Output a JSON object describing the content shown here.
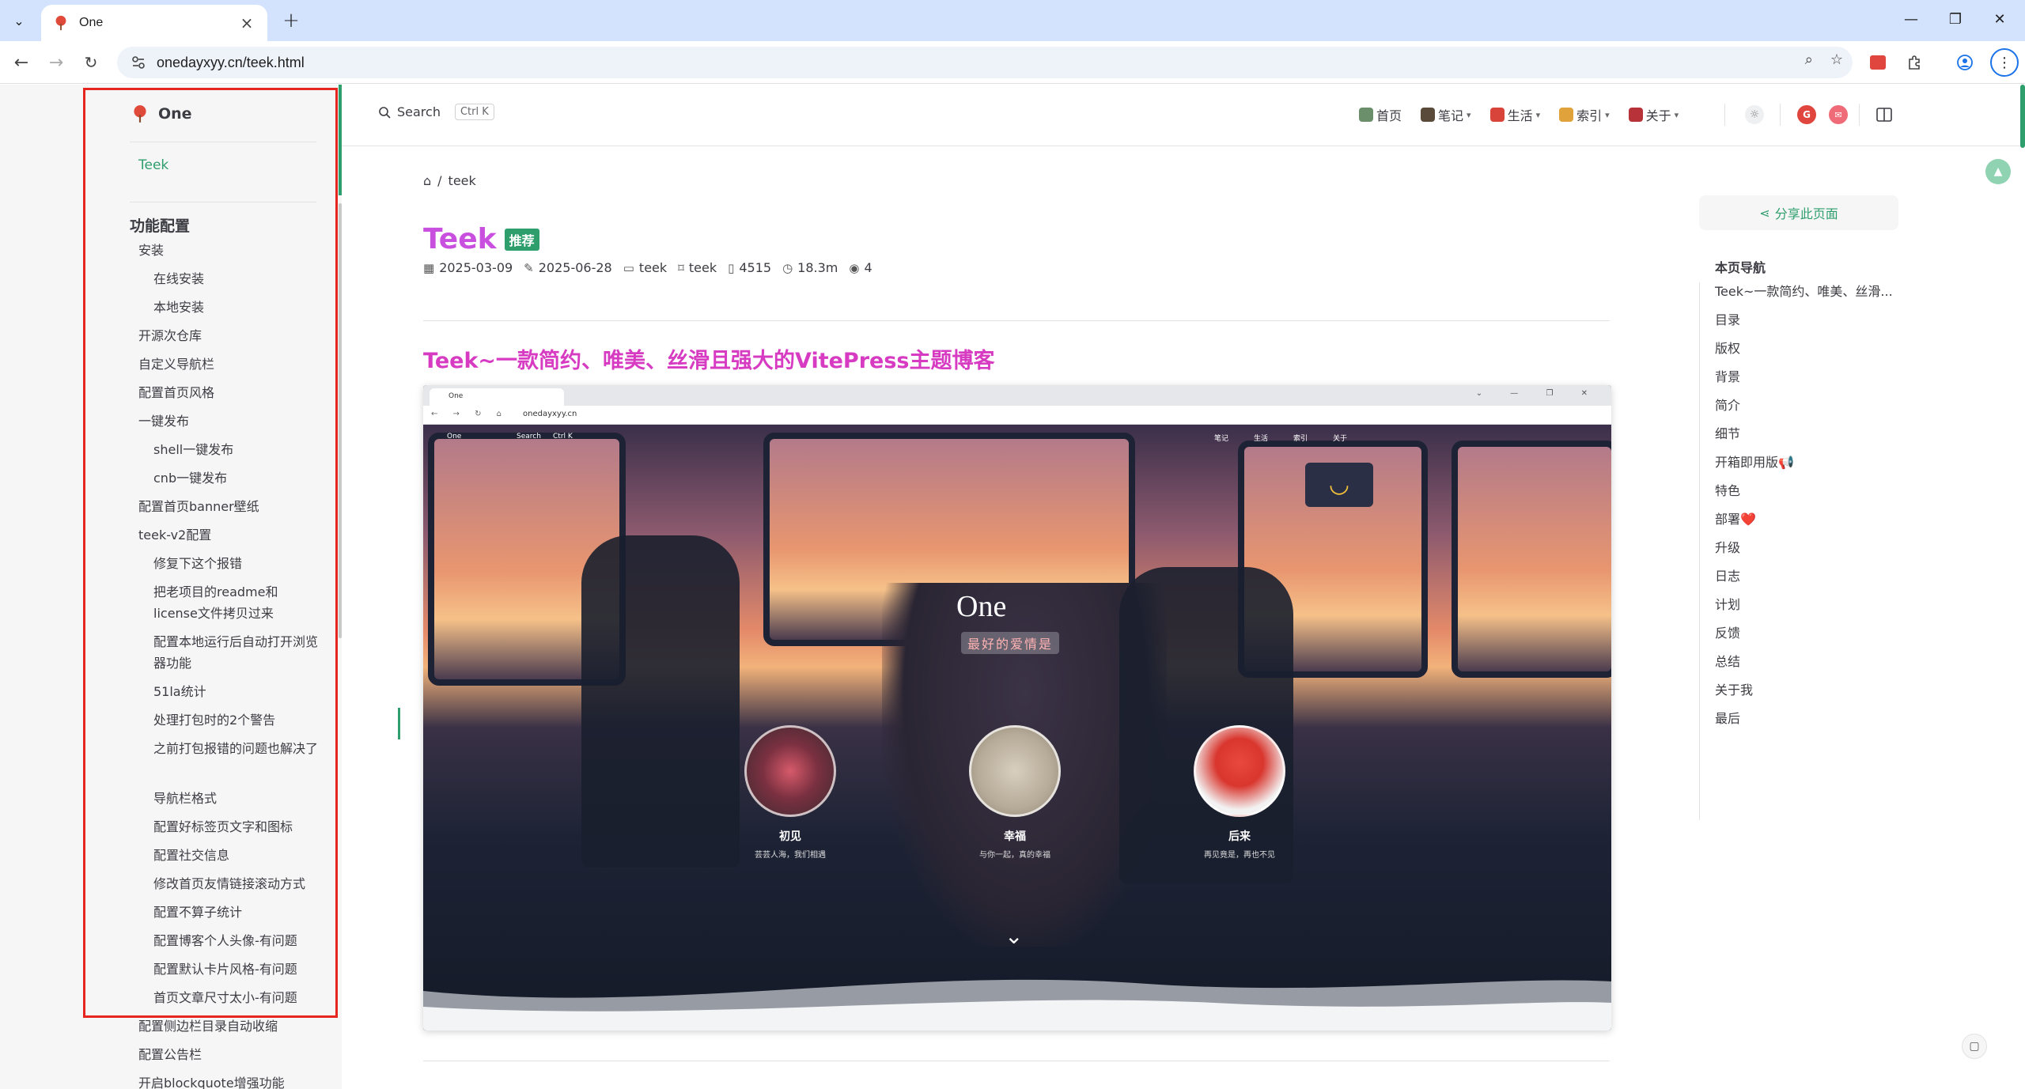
{
  "browser": {
    "tab_title": "One",
    "url": "onedayxyy.cn/teek.html"
  },
  "site": {
    "logo_text": "One",
    "search_label": "Search",
    "search_kbd": "Ctrl K",
    "nav": [
      {
        "label": "首页",
        "has_dropdown": false
      },
      {
        "label": "笔记",
        "has_dropdown": true
      },
      {
        "label": "生活",
        "has_dropdown": true
      },
      {
        "label": "索引",
        "has_dropdown": true
      },
      {
        "label": "关于",
        "has_dropdown": true
      }
    ]
  },
  "sidebar": {
    "top_link": "Teek",
    "section_title": "功能配置",
    "items": [
      {
        "label": "安装",
        "level": 1
      },
      {
        "label": "在线安装",
        "level": 2
      },
      {
        "label": "本地安装",
        "level": 2
      },
      {
        "label": "开源次仓库",
        "level": 1
      },
      {
        "label": "自定义导航栏",
        "level": 1
      },
      {
        "label": "配置首页风格",
        "level": 1
      },
      {
        "label": "一键发布",
        "level": 1
      },
      {
        "label": "shell一键发布",
        "level": 2
      },
      {
        "label": "cnb一键发布",
        "level": 2
      },
      {
        "label": "配置首页banner壁纸",
        "level": 1
      },
      {
        "label": "teek-v2配置",
        "level": 1
      },
      {
        "label": "修复下这个报错",
        "level": 2
      },
      {
        "label": "把老项目的readme和license文件拷贝过来",
        "level": 2
      },
      {
        "label": "配置本地运行后自动打开浏览器功能",
        "level": 2
      },
      {
        "label": "51la统计",
        "level": 2
      },
      {
        "label": "处理打包时的2个警告",
        "level": 2
      },
      {
        "label": "之前打包报错的问题也解决了",
        "level": 2
      },
      {
        "label": "导航栏格式",
        "level": 2
      },
      {
        "label": "配置好标签页文字和图标",
        "level": 2
      },
      {
        "label": "配置社交信息",
        "level": 2
      },
      {
        "label": "修改首页友情链接滚动方式",
        "level": 2
      },
      {
        "label": "配置不算子统计",
        "level": 2
      },
      {
        "label": "配置博客个人头像-有问题",
        "level": 2
      },
      {
        "label": "配置默认卡片风格-有问题",
        "level": 2
      },
      {
        "label": "首页文章尺寸太小-有问题",
        "level": 2
      },
      {
        "label": "配置侧边栏目录自动收缩",
        "level": 1
      },
      {
        "label": "配置公告栏",
        "level": 1
      },
      {
        "label": "开启blockquote增强功能",
        "level": 1
      }
    ]
  },
  "article": {
    "breadcrumb": "teek",
    "title": "Teek",
    "badge": "推荐",
    "meta": {
      "created": "2025-03-09",
      "updated": "2025-06-28",
      "category": "teek",
      "tag": "teek",
      "words": "4515",
      "read_time": "18.3m",
      "views": "4"
    },
    "heading": "Teek~一款简约、唯美、丝滑且强大的VitePress主题博客",
    "screenshot": {
      "tab_title": "One",
      "url": "onedayxyy.cn",
      "logo": "One",
      "search": "Search",
      "kbd": "Ctrl K",
      "nav": [
        "笔记",
        "生活",
        "索引",
        "关于"
      ],
      "hero_title": "One",
      "hero_subtitle": "最好的爱情是",
      "cards": [
        {
          "title": "初见",
          "subtitle": "芸芸人海，我们相遇"
        },
        {
          "title": "幸福",
          "subtitle": "与你一起，真的幸福"
        },
        {
          "title": "后来",
          "subtitle": "再见竟是，再也不见"
        }
      ]
    }
  },
  "aside": {
    "share_label": "分享此页面",
    "toc_title": "本页导航",
    "toc": [
      "Teek~一款简约、唯美、丝滑...",
      "目录",
      "版权",
      "背景",
      "简介",
      "细节",
      "开箱即用版📢",
      "特色",
      "部署❤️",
      "升级",
      "日志",
      "计划",
      "反馈",
      "总结",
      "关于我",
      "最后"
    ]
  },
  "colors": {
    "brand": "#2f9e6d",
    "title": "#c94fdf",
    "heading": "#d63bc2",
    "highlight_box": "#e5261f"
  }
}
